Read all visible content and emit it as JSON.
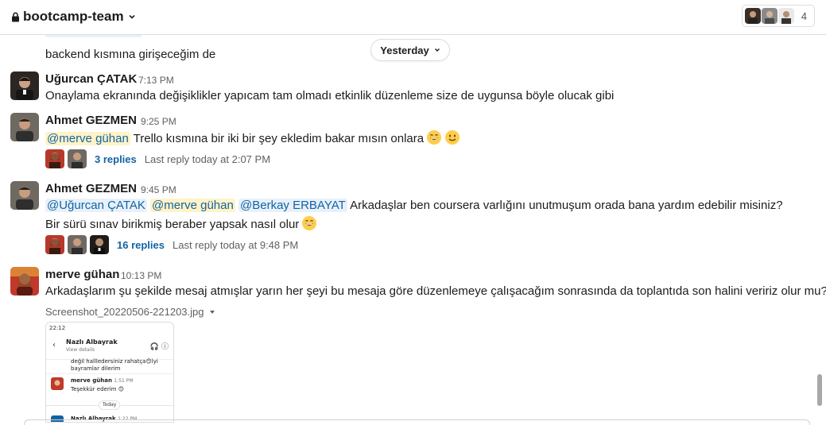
{
  "header": {
    "channel_name": "bootcamp-team",
    "member_count": "4"
  },
  "divider": {
    "label": "Yesterday"
  },
  "prev_message": {
    "text": "backend kısmına girişeceğim de"
  },
  "messages": [
    {
      "author": "Uğurcan ÇATAK",
      "time": "7:13 PM",
      "text": "Onaylama ekranında değişiklikler yapıcam tam olmadı etkinlik düzenleme size de uygunsa böyle olucak gibi"
    },
    {
      "author": "Ahmet GEZMEN",
      "time": "9:25 PM",
      "mention": "@merve gühan",
      "text": " Trello kısmına bir iki bir şey ekledim bakar mısın onlara",
      "emojis": [
        "grinning-emoji",
        "slightly-smiling-emoji"
      ],
      "thread": {
        "replies": "3 replies",
        "last_reply": "Last reply today at 2:07 PM"
      }
    },
    {
      "author": "Ahmet GEZMEN",
      "time": "9:45 PM",
      "mentions": [
        "@Uğurcan ÇATAK",
        "@merve gühan",
        "@Berkay ERBAYAT"
      ],
      "text_line1": " Arkadaşlar ben coursera varlığını unutmuşum orada bana yardım edebilir misiniz?",
      "text_line2": "Bir sürü sınav birikmiş beraber yapsak nasıl olur",
      "emojis": [
        "grinning-emoji"
      ],
      "thread": {
        "replies": "16 replies",
        "last_reply": "Last reply today at 9:48 PM"
      }
    },
    {
      "author": "merve gühan",
      "time": "10:13 PM",
      "text": "Arkadaşlarım şu şekilde mesaj atmışlar yarın her şeyi bu mesaja göre düzenlemeye çalışacağım sonrasında da toplantıda son halini veririz olur mu?",
      "attachment": {
        "file_name": "Screenshot_20220506-221203.jpg",
        "preview": {
          "status_time": "22:12",
          "contact_name": "Nazlı Albayrak",
          "view_details": "View details",
          "line1": "değil hallledersiniz rahatça😊lyi",
          "line2": "bayramlar dilerim",
          "msg_author": "merve gühan",
          "msg_time": "1:51 PM",
          "msg_text": "Teşekkür ederim 😊",
          "day_label": "Today",
          "next_author": "Nazlı Albayrak",
          "next_time": "1:22 PM"
        }
      }
    }
  ],
  "colors": {
    "mention_bg": "#e8f1fa",
    "self_mention_bg": "#fff3c7",
    "link": "#1264a3"
  }
}
